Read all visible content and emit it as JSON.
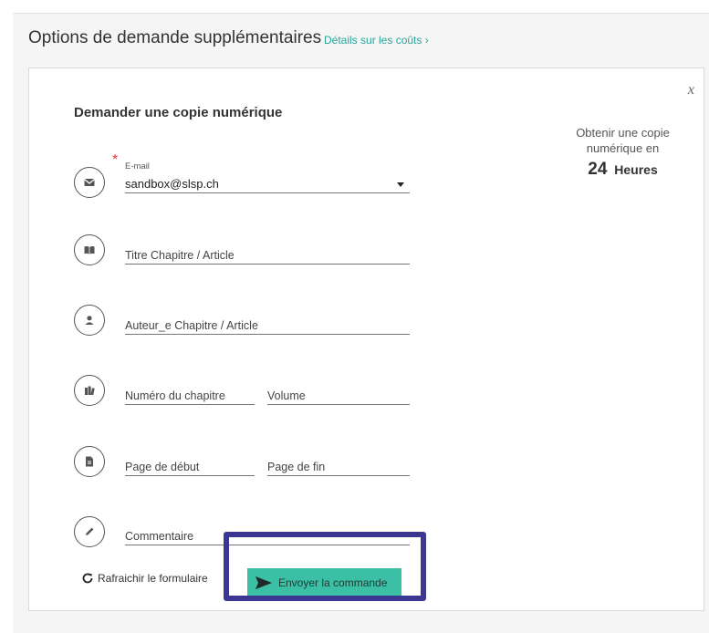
{
  "header": {
    "title": "Options de demande supplémentaires",
    "cost_link": "Détails sur les coûts ›"
  },
  "form": {
    "close_label": "x",
    "title": "Demander une copie numérique",
    "required_mark": "*",
    "email": {
      "label": "E-mail",
      "value": "sandbox@slsp.ch"
    },
    "chapter_title_placeholder": "Titre Chapitre / Article",
    "chapter_author_placeholder": "Auteur_e Chapitre / Article",
    "chapter_number_placeholder": "Numéro du chapitre",
    "volume_placeholder": "Volume",
    "page_start_placeholder": "Page de début",
    "page_end_placeholder": "Page de fin",
    "comment_placeholder": "Commentaire",
    "refresh_label": "Rafraichir le formulaire",
    "submit_label": "Envoyer la commande"
  },
  "side_info": {
    "text": "Obtenir une copie numérique en",
    "hours_number": "24",
    "hours_unit": "Heures"
  },
  "icons": {
    "email": "envelope-icon",
    "title": "book-icon",
    "author": "person-icon",
    "chapter": "books-icon",
    "pages": "document-icon",
    "comment": "pencil-icon",
    "refresh": "refresh-icon",
    "submit": "send-icon"
  },
  "colors": {
    "accent": "#26a69a",
    "button": "#3bbfa5",
    "highlight": "#3b3692",
    "required": "#e53935"
  }
}
